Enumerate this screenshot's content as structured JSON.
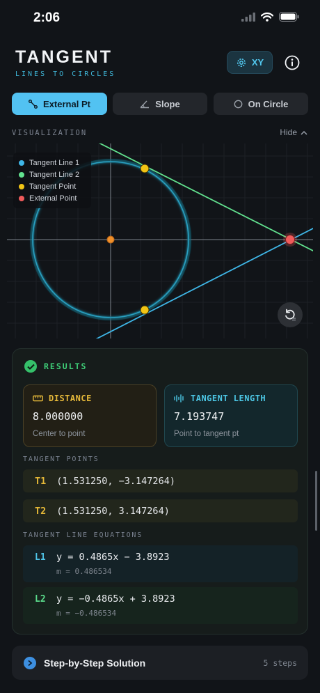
{
  "status": {
    "time": "2:06",
    "icons": [
      "signal-icon",
      "wifi-icon",
      "battery-icon"
    ]
  },
  "header": {
    "title": "TANGENT",
    "subtitle": "LINES TO CIRCLES",
    "xy_label": "XY"
  },
  "tabs": [
    {
      "label": "External Pt",
      "icon": "line-segment-icon",
      "active": true
    },
    {
      "label": "Slope",
      "icon": "angle-icon",
      "active": false
    },
    {
      "label": "On Circle",
      "icon": "circle-icon",
      "active": false
    }
  ],
  "visualization": {
    "section_label": "VISUALIZATION",
    "hide_label": "Hide",
    "legend": [
      {
        "label": "Tangent Line 1",
        "color": "#3fb7e8"
      },
      {
        "label": "Tangent Line 2",
        "color": "#62e28f"
      },
      {
        "label": "Tangent Point",
        "color": "#f2c515"
      },
      {
        "label": "External Point",
        "color": "#f05b5b"
      }
    ]
  },
  "results": {
    "title": "RESULTS",
    "distance": {
      "label": "DISTANCE",
      "value": "8.000000",
      "caption": "Center to point"
    },
    "tangent_length": {
      "label": "TANGENT LENGTH",
      "value": "7.193747",
      "caption": "Point to tangent pt"
    },
    "points_label": "TANGENT POINTS",
    "points": [
      {
        "tag": "T1",
        "value": "(1.531250, −3.147264)"
      },
      {
        "tag": "T2",
        "value": "(1.531250, 3.147264)"
      }
    ],
    "equations_label": "TANGENT LINE EQUATIONS",
    "equations": [
      {
        "tag": "L1",
        "equation": "y = 0.4865x − 3.8923",
        "slope": "m = 0.486534"
      },
      {
        "tag": "L2",
        "equation": "y = −0.4865x + 3.8923",
        "slope": "m = −0.486534"
      }
    ]
  },
  "steps": {
    "label": "Step-by-Step Solution",
    "count": "5 steps"
  },
  "colors": {
    "accent": "#52c2f2",
    "success": "#35c06a",
    "distance": "#e6b93a",
    "tangent": "#4cc6e4"
  }
}
